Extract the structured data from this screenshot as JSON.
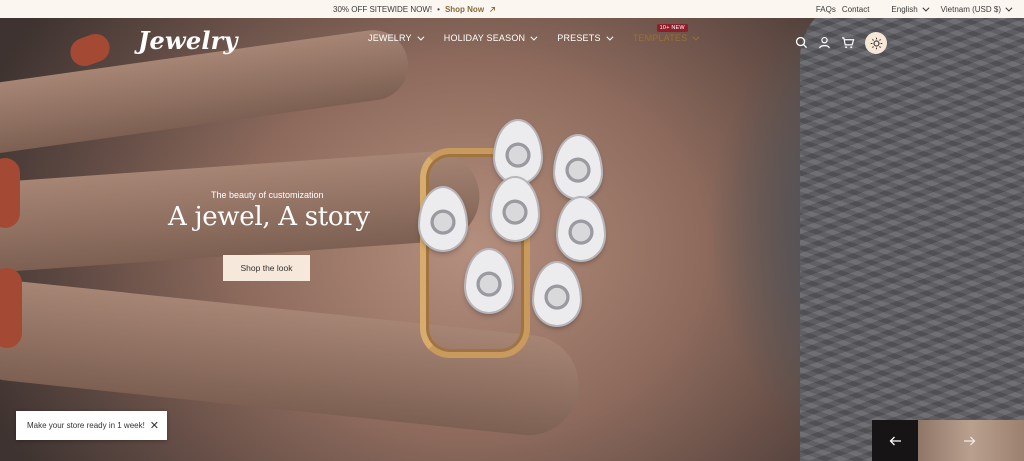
{
  "announcement": {
    "promo_text": "30% OFF SITEWIDE NOW!",
    "separator": "•",
    "promo_link": "Shop Now",
    "faqs": "FAQs",
    "contact": "Contact",
    "language": "English",
    "currency": "Vietnam (USD $)"
  },
  "header": {
    "logo": "Jewelry",
    "nav": [
      {
        "label": "JEWELRY"
      },
      {
        "label": "HOLIDAY SEASON"
      },
      {
        "label": "PRESETS"
      },
      {
        "label": "TEMPLATES",
        "badge": "10+ NEW"
      }
    ],
    "icons": [
      "search-icon",
      "account-icon",
      "cart-icon",
      "sun-icon"
    ]
  },
  "hero": {
    "kicker": "The beauty of customization",
    "headline": "A jewel, A story",
    "cta": "Shop the look"
  },
  "toast": {
    "message": "Make your store ready in 1 week!",
    "close": "✕"
  },
  "slider": {
    "prev": "←",
    "next": "→"
  },
  "colors": {
    "topbar_bg": "#fbf6ef",
    "accent_gold": "#8a6a3a",
    "badge_red": "#8c1f2a",
    "cta_bg": "#f6e8da"
  }
}
